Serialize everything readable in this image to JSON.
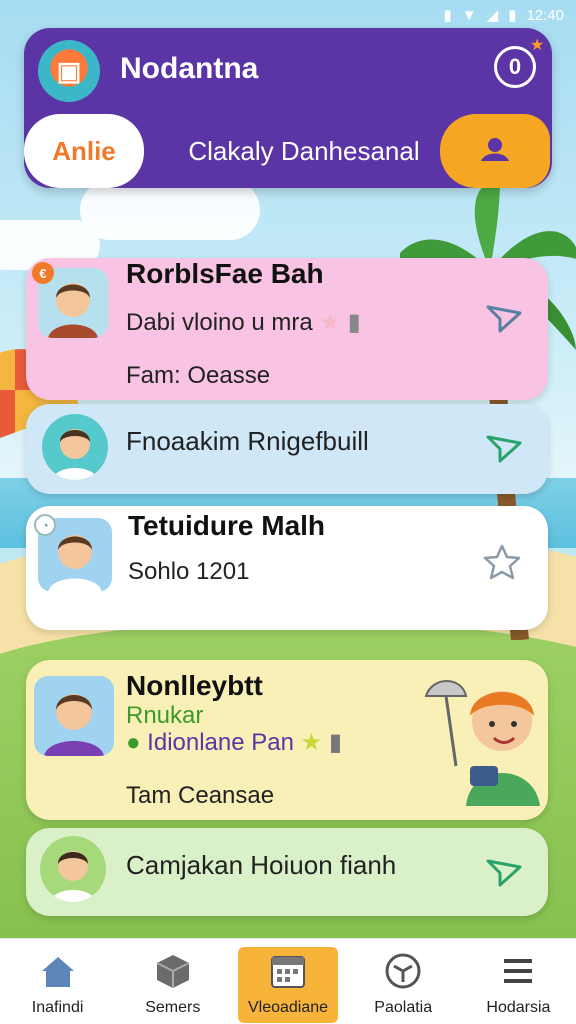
{
  "status": {
    "time": "12:40"
  },
  "header": {
    "title": "Nodantna",
    "chip_label": "Anlie",
    "search_text": "Clakaly Danhesanal"
  },
  "cards": [
    {
      "name": "RorblsFae Bah",
      "line1": "Dabi vloino u mra",
      "line2": "Fam: Oeasse",
      "badge": "€",
      "color": "#f9c4e4"
    },
    {
      "name": "",
      "line1": "Fnoaakim Rnigefbuill",
      "line2": "",
      "badge": "",
      "color": "#cfe7f7"
    },
    {
      "name": "Tetuidure Malh",
      "line1": "Sohlo 1201",
      "line2": "",
      "badge": "",
      "color": "#ffffff"
    },
    {
      "name": "Nonlleybtt",
      "sub": "Rnukar",
      "line1": "Idionlane Pan",
      "line2": "Tam Ceansae",
      "badge": "",
      "color": "#f8f0b6"
    },
    {
      "name": "",
      "line1": "Camjakan Hoiuon fianh",
      "line2": "",
      "badge": "",
      "color": "#d9f0c9"
    }
  ],
  "nav": [
    {
      "label": "Inafindi",
      "icon": "home-icon"
    },
    {
      "label": "Semers",
      "icon": "cube-icon"
    },
    {
      "label": "Vleoadiane",
      "icon": "calendar-icon",
      "active": true
    },
    {
      "label": "Paolatia",
      "icon": "compass-icon"
    },
    {
      "label": "Hodarsia",
      "icon": "menu-icon"
    }
  ]
}
